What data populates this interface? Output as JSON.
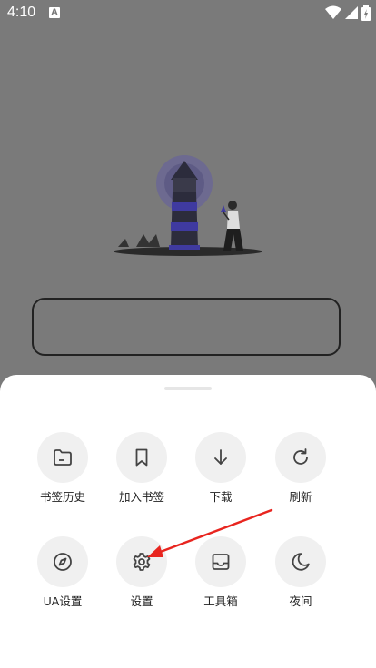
{
  "status_bar": {
    "time": "4:10",
    "notification_letter": "A"
  },
  "menu": {
    "row1": [
      {
        "label": "书签历史",
        "icon": "folder-icon"
      },
      {
        "label": "加入书签",
        "icon": "bookmark-icon"
      },
      {
        "label": "下载",
        "icon": "download-arrow-icon"
      },
      {
        "label": "刷新",
        "icon": "refresh-icon"
      }
    ],
    "row2": [
      {
        "label": "UA设置",
        "icon": "compass-icon"
      },
      {
        "label": "设置",
        "icon": "gear-icon"
      },
      {
        "label": "工具箱",
        "icon": "inbox-tray-icon"
      },
      {
        "label": "夜间",
        "icon": "moon-icon"
      }
    ]
  },
  "colors": {
    "scrim": "#7a7a7a",
    "accent_arrow": "#e8251f",
    "illustration_purple": "#3f3aa0"
  }
}
